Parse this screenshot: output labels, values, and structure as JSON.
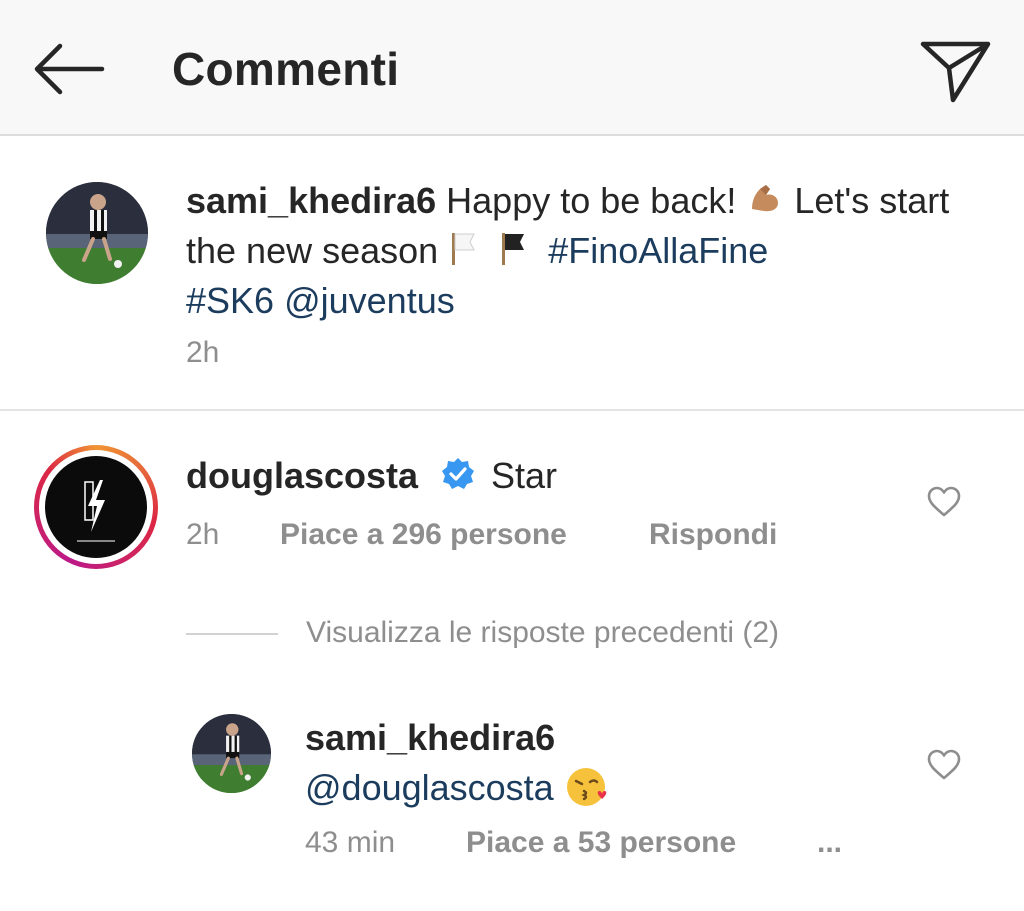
{
  "header": {
    "title": "Commenti"
  },
  "caption": {
    "username": "sami_khedira6",
    "text_1": " Happy to be back! ",
    "text_2": " Let's start the new season ",
    "hashtag_1": "#FinoAllaFine",
    "hashtag_2": "#SK6",
    "mention": "@juventus",
    "time": "2h"
  },
  "comment": {
    "username": "douglascosta",
    "text": "Star",
    "time": "2h",
    "likes": "Piace a 296 persone",
    "reply": "Rispondi"
  },
  "replies_toggle": {
    "label": "Visualizza le risposte precedenti (2)"
  },
  "reply": {
    "username": "sami_khedira6",
    "mention": "@douglascosta",
    "time": "43 min",
    "likes": "Piace a 53 persone",
    "more": "..."
  },
  "colors": {
    "link": "#1c3c5e",
    "meta": "#8e8e8e",
    "text": "#262626",
    "verified": "#3897f0",
    "header_bg": "#f8f8f8",
    "story_ring_start": "#f09433",
    "story_ring_end": "#bc1888"
  },
  "icons": [
    "back-arrow-icon",
    "send-icon",
    "flexed-biceps-emoji",
    "white-flag-emoji",
    "black-flag-emoji",
    "verified-badge-icon",
    "heart-outline-icon",
    "kiss-emoji"
  ]
}
